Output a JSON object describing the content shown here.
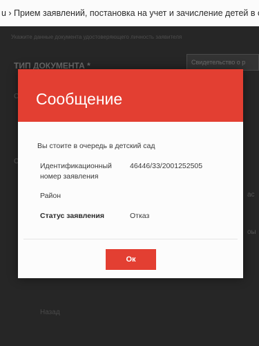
{
  "page": {
    "breadcrumb": "u › Прием заявлений, постановка на учет и зачисление детей в обра"
  },
  "background": {
    "hint": "Укажите данные документа удостоверяющего личность заявителя",
    "doc_type_label": "ТИП ДОКУМЕНТА *",
    "doc_type_value": "Свидетельство о р",
    "left_fragment_1": "С",
    "left_fragment_2": "С",
    "right_fragment_1": "ас",
    "right_fragment_2": "оы",
    "bottom_link": "Назад"
  },
  "dialog": {
    "title": "Сообщение",
    "message": "Вы стоите в очередь в детский сад",
    "id_label_line1": "Идентификационный",
    "id_label_line2": "номер заявления",
    "id_value": "46446/33/2001252505",
    "district_label": "Район",
    "status_label": "Статус заявления",
    "status_value": "Отказ",
    "ok_label": "Ок"
  },
  "colors": {
    "accent": "#e33f32",
    "overlay": "#262626"
  }
}
